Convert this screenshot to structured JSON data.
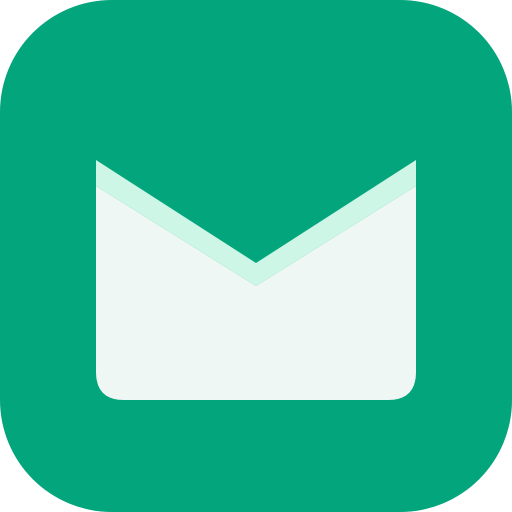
{
  "icon": {
    "name": "mail-icon",
    "colors": {
      "tile": "#03a57c",
      "envelope_body": "#eff7f4",
      "flap_accent": "#cdf6e6"
    }
  }
}
